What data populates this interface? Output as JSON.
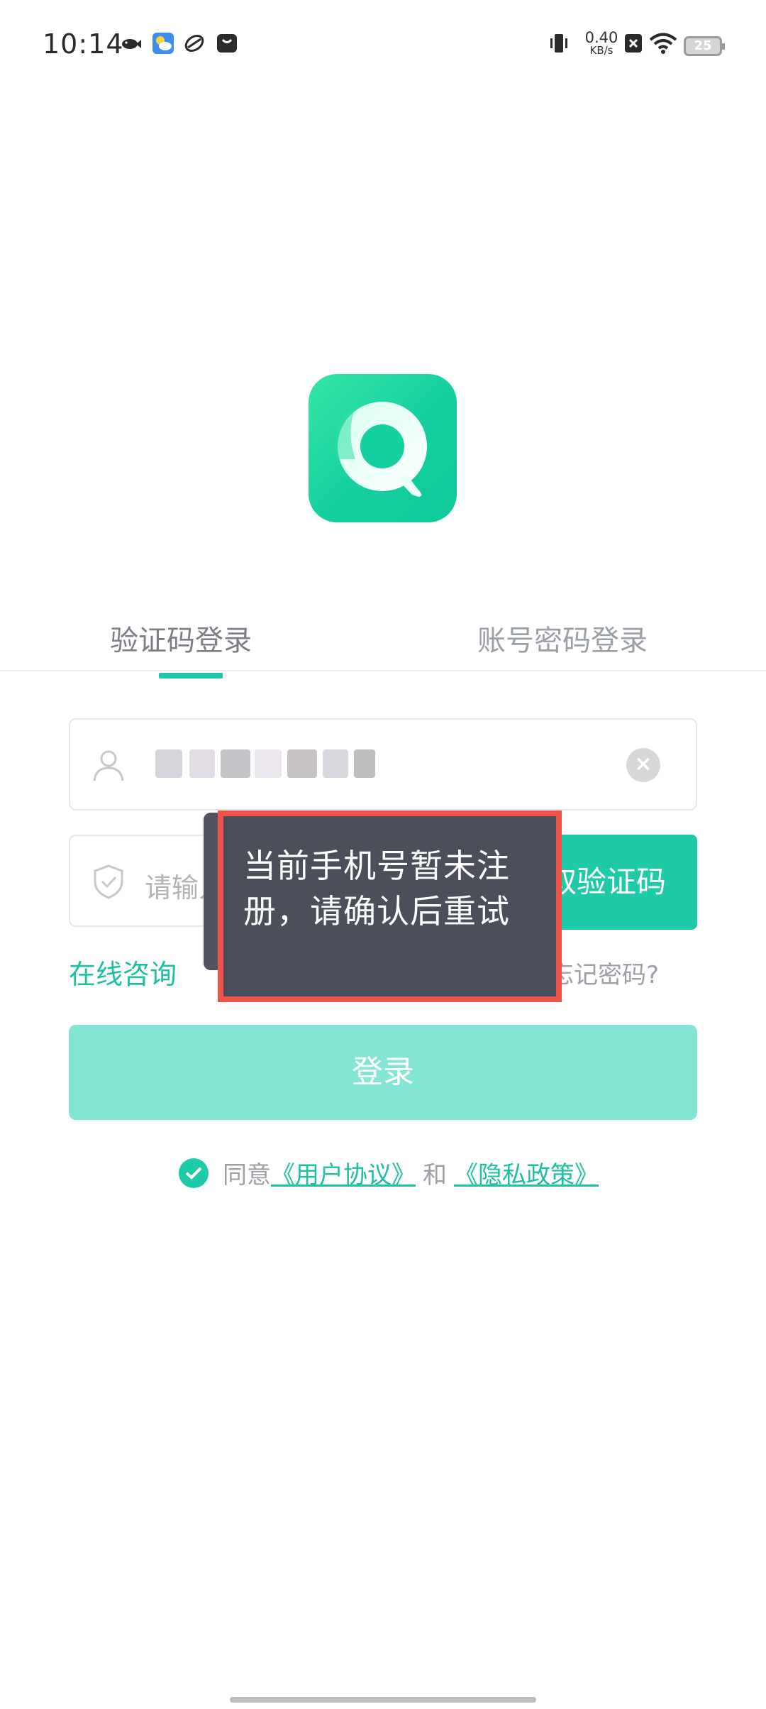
{
  "status_bar": {
    "time": "10:14",
    "net_speed_value": "0.40",
    "net_speed_unit": "KB/s",
    "battery": "25",
    "icons": [
      "fish-notification-icon",
      "weather-app-icon",
      "sync-app-icon",
      "bag-app-icon",
      "vibrate-icon",
      "no-sim-icon",
      "wifi-icon",
      "battery-icon"
    ]
  },
  "tabs": {
    "sms_login": "验证码登录",
    "password_login": "账号密码登录",
    "active": "sms_login"
  },
  "form": {
    "phone_value": "",
    "code_placeholder": "请输入验证码",
    "get_code_label": "获取验证码",
    "consult_label": "在线咨询",
    "forgot_label": "忘记密码?",
    "login_label": "登录"
  },
  "agreement": {
    "prefix": "同意",
    "user_agreement": "《用户协议》",
    "conjunction": "和",
    "privacy_policy": "《隐私政策》",
    "checked": true
  },
  "toast": {
    "message": "当前手机号暂未注册，请确认后重试"
  },
  "colors": {
    "brand": "#1fcaa8",
    "login_disabled": "#83e6d4",
    "toast_bg": "#4a4f59",
    "highlight_border": "#ee5249"
  }
}
